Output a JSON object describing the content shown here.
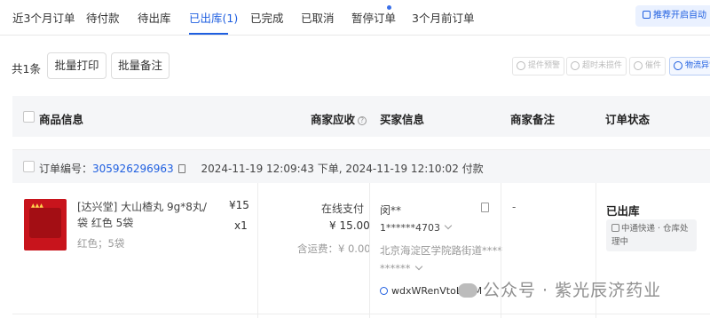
{
  "tabs": [
    {
      "label": "近3个月订单"
    },
    {
      "label": "待付款"
    },
    {
      "label": "待出库"
    },
    {
      "label": "已出库(1)",
      "active": true
    },
    {
      "label": "已完成"
    },
    {
      "label": "已取消"
    },
    {
      "label": "暂停订单"
    },
    {
      "label": "3个月前订单"
    }
  ],
  "promo_label": "推荐开启自动",
  "toolbar": {
    "count_label": "共1条",
    "batch_print": "批量打印",
    "batch_remark": "批量备注",
    "small_buttons": [
      "提件预警",
      "超时未揽件",
      "催件",
      "物流异常"
    ]
  },
  "table_header": {
    "product": "商品信息",
    "merchant_receivable": "商家应收",
    "help_icon_glyph": "?",
    "buyer": "买家信息",
    "merchant_remark": "商家备注",
    "order_status": "订单状态"
  },
  "order": {
    "number_label": "订单编号：",
    "number": "305926296963",
    "order_time": "2024-11-19 12:09:43 下单",
    "pay_time": "2024-11-19 12:10:02 付款",
    "product_name": "[达兴堂] 大山楂丸 9g*8丸/袋 红色 5袋",
    "product_spec": "红色；5袋",
    "unit_price": "¥15",
    "quantity": "x1",
    "pay_method": "在线支付",
    "pay_amount": "¥ 15.00",
    "freight": "含运费：¥ 0.00",
    "buyer_name": "闵**",
    "buyer_phone": "1******4703",
    "buyer_address": "北京海淀区学院路街道**** ******",
    "buyer_wx": "wdxWRenVtoLYDM",
    "remark": "-",
    "status": "已出库",
    "logistics": "中通快递 · 仓库处理中"
  },
  "watermark": "公众号 · 紫光辰济药业",
  "colors": {
    "accent": "#1f5fe0",
    "product_red": "#c8141c"
  }
}
